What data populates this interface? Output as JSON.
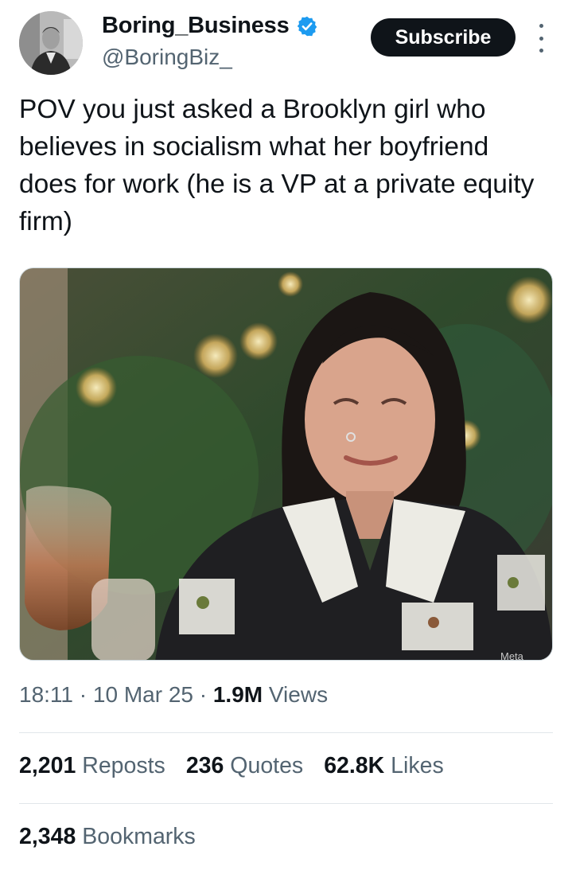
{
  "author": {
    "display_name": "Boring_Business",
    "handle": "@BoringBiz_",
    "verified": true,
    "verified_color": "#1d9bf0"
  },
  "actions": {
    "subscribe_label": "Subscribe",
    "more_icon": "more-vertical-icon"
  },
  "tweet": {
    "text": "POV you just asked a Brooklyn girl who believes in socialism what her boyfriend does for work (he is a VP at a private equity firm)",
    "media_watermark": "Meta"
  },
  "meta": {
    "time": "18:11",
    "separator": "·",
    "date": "10 Mar 25",
    "views_count": "1.9M",
    "views_label": "Views"
  },
  "stats": [
    {
      "count": "2,201",
      "label": "Reposts"
    },
    {
      "count": "236",
      "label": "Quotes"
    },
    {
      "count": "62.8K",
      "label": "Likes"
    }
  ],
  "bookmarks": {
    "count": "2,348",
    "label": "Bookmarks"
  },
  "colors": {
    "text_primary": "#0f1419",
    "text_secondary": "#536471",
    "button_bg": "#0f1419",
    "divider": "#e1e6ea"
  }
}
